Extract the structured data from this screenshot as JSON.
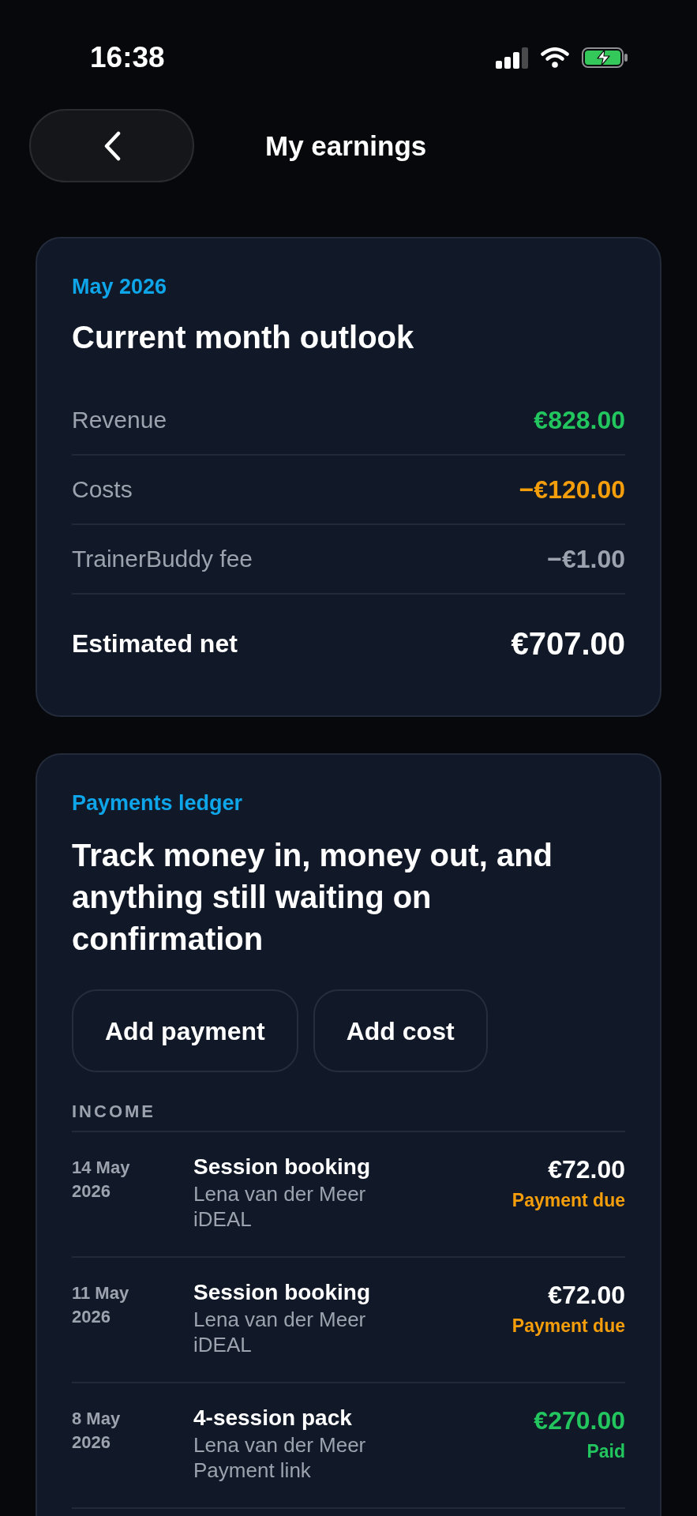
{
  "status_bar": {
    "time": "16:38"
  },
  "header": {
    "title": "My earnings"
  },
  "outlook": {
    "eyebrow": "May 2026",
    "title": "Current month outlook",
    "rows": [
      {
        "label": "Revenue",
        "value": "€828.00",
        "color": "#22c55e"
      },
      {
        "label": "Costs",
        "value": "−€120.00",
        "color": "#f59e0b"
      },
      {
        "label": "TrainerBuddy fee",
        "value": "−€1.00",
        "color": "#9ca3af"
      }
    ],
    "total": {
      "label": "Estimated net",
      "value": "€707.00"
    }
  },
  "ledger": {
    "eyebrow": "Payments ledger",
    "title": "Track money in, money out, and anything still waiting on confirmation",
    "buttons": [
      "Add payment",
      "Add cost"
    ],
    "income": {
      "heading": "INCOME",
      "entries": [
        {
          "date": "14 May 2026",
          "title": "Session booking",
          "client": "Lena van der Meer",
          "method": "iDEAL",
          "amount": "€72.00",
          "status": "Payment due",
          "paid": false
        },
        {
          "date": "11 May 2026",
          "title": "Session booking",
          "client": "Lena van der Meer",
          "method": "iDEAL",
          "amount": "€72.00",
          "status": "Payment due",
          "paid": false
        },
        {
          "date": "8 May 2026",
          "title": "4-session pack",
          "client": "Lena van der Meer",
          "method": "Payment link",
          "amount": "€270.00",
          "status": "Paid",
          "paid": true
        }
      ]
    }
  }
}
